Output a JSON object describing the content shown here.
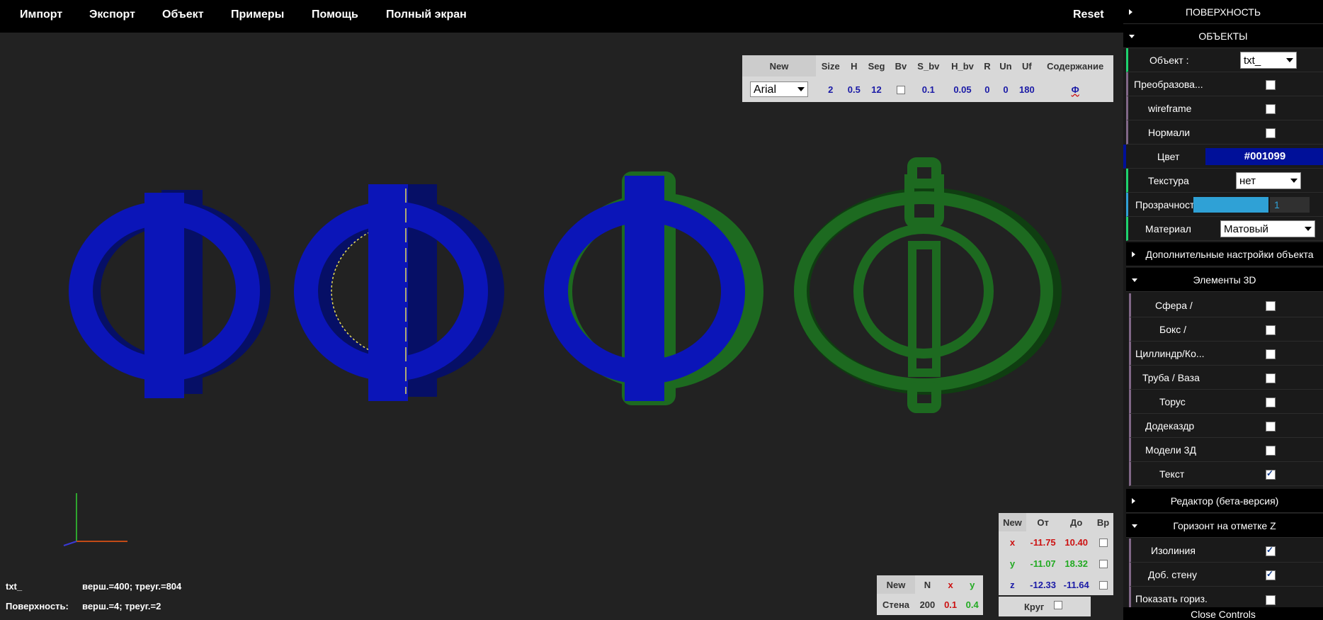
{
  "menu": {
    "items": [
      "Импорт",
      "Экспорт",
      "Объект",
      "Примеры",
      "Помощь",
      "Полный экран"
    ],
    "reset": "Reset"
  },
  "text_params": {
    "headers": [
      "New",
      "Size",
      "H",
      "Seg",
      "Bv",
      "S_bv",
      "H_bv",
      "R",
      "Un",
      "Uf",
      "Содержание"
    ],
    "font": "Arial",
    "size": "2",
    "h": "0.5",
    "seg": "12",
    "bv_checked": false,
    "s_bv": "0.1",
    "h_bv": "0.05",
    "r": "0",
    "un": "0",
    "uf": "180",
    "content": "Ф"
  },
  "scene": {
    "glyph": "Ф",
    "colors": {
      "blue": "#0b15b8",
      "blue_dark": "#060f66",
      "green": "#1d6a20",
      "green_dark": "#0f3e11",
      "outline": "#e8dd5a"
    }
  },
  "info": {
    "name": "txt_",
    "name_stats": "верш.=400; треуг.=804",
    "surface_label": "Поверхность:",
    "surface_stats": "верш.=4; треуг.=2"
  },
  "wall_table": {
    "headers": [
      "New",
      "N",
      "x",
      "y"
    ],
    "row_label": "Стена",
    "n": "200",
    "x": "0.1",
    "y": "0.4"
  },
  "range_table": {
    "headers": [
      "New",
      "От",
      "До",
      "Вр"
    ],
    "rows": [
      {
        "axis": "x",
        "from": "-11.75",
        "to": "10.40",
        "color": "#cc1111"
      },
      {
        "axis": "y",
        "from": "-11.07",
        "to": "18.32",
        "color": "#22aa22"
      },
      {
        "axis": "z",
        "from": "-12.33",
        "to": "-11.64",
        "color": "#1a1aa6"
      }
    ],
    "circle_label": "Круг"
  },
  "panel": {
    "surface_folder": "ПОВЕРХНОСТЬ",
    "objects_folder": "ОБЪЕКТЫ",
    "object_label": "Объект :",
    "object_value": "txt_",
    "transform_label": "Преобразова...",
    "wireframe_label": "wireframe",
    "normals_label": "Нормали",
    "color_label": "Цвет",
    "color_value": "#001099",
    "texture_label": "Текстура",
    "texture_value": "нет",
    "opacity_label": "Прозрачность",
    "opacity_value": "1",
    "material_label": "Материал",
    "material_value": "Матовый",
    "extra_folder": "Дополнительные настройки объекта",
    "elements_folder": "Элементы 3D",
    "elements": [
      {
        "label": "Сфера /",
        "checked": false
      },
      {
        "label": "Бокс /",
        "checked": false
      },
      {
        "label": "Циллиндр/Ко...",
        "checked": false
      },
      {
        "label": "Труба / Ваза",
        "checked": false
      },
      {
        "label": "Торус",
        "checked": false
      },
      {
        "label": "Додеказдр",
        "checked": false
      },
      {
        "label": "Модели 3Д",
        "checked": false
      },
      {
        "label": "Текст",
        "checked": true
      }
    ],
    "editor_folder": "Редактор (бета-версия)",
    "horizon_folder": "Горизонт на отметке Z",
    "horizon_items": [
      {
        "label": "Изолиния",
        "checked": true
      },
      {
        "label": "Доб. стену",
        "checked": true
      },
      {
        "label": "Показать гориз.",
        "checked": false
      }
    ],
    "close_controls": "Close Controls"
  }
}
